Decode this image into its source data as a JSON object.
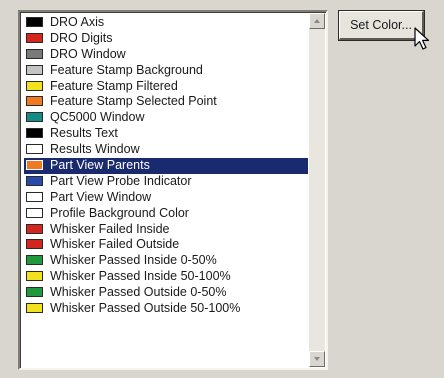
{
  "colors": {
    "selection": "#1a2a6e",
    "panel": "#d8d6cf"
  },
  "set_color_button": {
    "label": "Set Color..."
  },
  "items": [
    {
      "label": "DRO Axis",
      "color": "#000000"
    },
    {
      "label": "DRO Digits",
      "color": "#d2261e"
    },
    {
      "label": "DRO Window",
      "color": "#7a7a7a"
    },
    {
      "label": "Feature Stamp Background",
      "color": "#c4c4c4"
    },
    {
      "label": "Feature Stamp Filtered",
      "color": "#f0e21c"
    },
    {
      "label": "Feature Stamp Selected Point",
      "color": "#ef7a22"
    },
    {
      "label": "QC5000 Window",
      "color": "#168a84"
    },
    {
      "label": "Results Text",
      "color": "#000000"
    },
    {
      "label": "Results Window",
      "color": "#ffffff"
    },
    {
      "label": "Part View Parents",
      "color": "#ef7a22",
      "selected": true
    },
    {
      "label": "Part View Probe Indicator",
      "color": "#2a4aa8"
    },
    {
      "label": "Part View Window",
      "color": "#ffffff"
    },
    {
      "label": "Profile Background Color",
      "color": "#ffffff"
    },
    {
      "label": "Whisker Failed Inside",
      "color": "#d2261e"
    },
    {
      "label": "Whisker Failed Outside",
      "color": "#d2261e"
    },
    {
      "label": "Whisker Passed Inside 0-50%",
      "color": "#1e9a3c"
    },
    {
      "label": "Whisker Passed Inside 50-100%",
      "color": "#f0e21c"
    },
    {
      "label": "Whisker Passed Outside 0-50%",
      "color": "#1e9a3c"
    },
    {
      "label": "Whisker Passed Outside 50-100%",
      "color": "#f0e21c"
    }
  ],
  "icons": {
    "scroll_up": "scroll-up-arrow-icon",
    "scroll_down": "scroll-down-arrow-icon",
    "cursor": "mouse-pointer-icon"
  }
}
